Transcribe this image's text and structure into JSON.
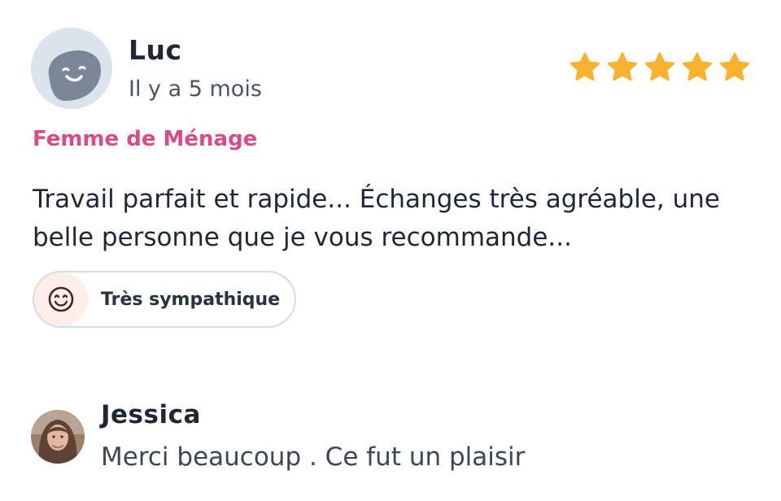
{
  "review": {
    "reviewer_name": "Luc",
    "date": "Il y a 5 mois",
    "rating": 5,
    "rating_max": 5,
    "category": "Femme de Ménage",
    "text": "Travail parfait et rapide... Échanges très agréable, une belle personne que je vous recommande...",
    "badge": {
      "icon": "smiley-face-icon",
      "label": "Très sympathique"
    }
  },
  "reply": {
    "author_name": "Jessica",
    "text": "Merci beaucoup . Ce fut un plaisir"
  },
  "colors": {
    "star": "#f7b22f",
    "category": "#d94a86",
    "text_dark": "#1f2733",
    "badge_border": "#d4dbe4"
  }
}
